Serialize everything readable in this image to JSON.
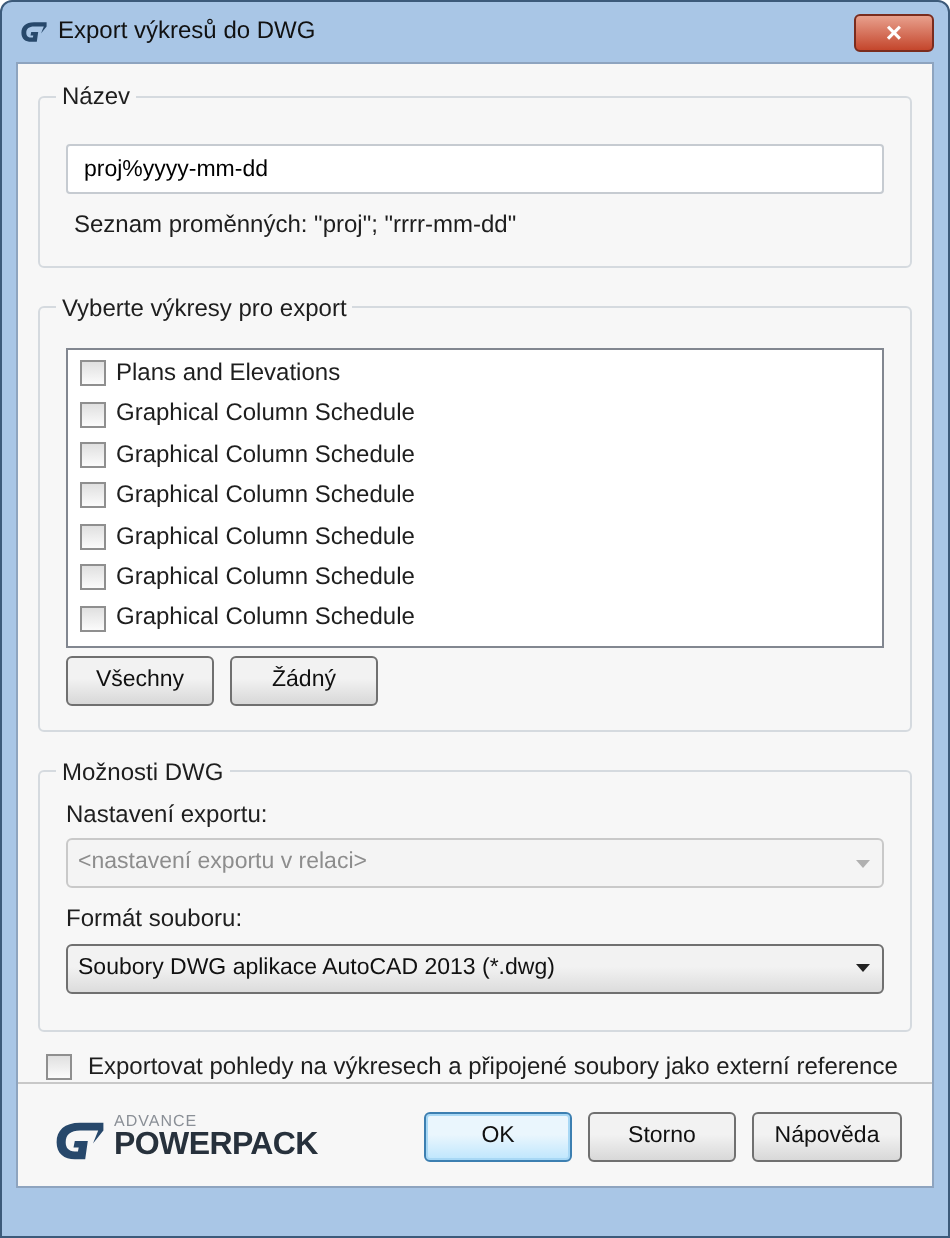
{
  "window": {
    "title": "Export výkresů do DWG",
    "close": "×"
  },
  "name_group": {
    "legend": "Název",
    "value": "proj%yyyy-mm-dd",
    "hint": "Seznam proměnných: \"proj\"; \"rrrr-mm-dd\""
  },
  "sheets_group": {
    "legend": "Vyberte výkresy pro export",
    "items": [
      {
        "label": "Plans and Elevations",
        "checked": false
      },
      {
        "label": "Graphical Column Schedule",
        "checked": false
      },
      {
        "label": "Graphical Column Schedule",
        "checked": false
      },
      {
        "label": "Graphical Column Schedule",
        "checked": false
      },
      {
        "label": "Graphical Column Schedule",
        "checked": false
      },
      {
        "label": "Graphical Column Schedule",
        "checked": false
      },
      {
        "label": "Graphical Column Schedule",
        "checked": false
      }
    ],
    "buttons": [
      "Všechny",
      "Žádný"
    ]
  },
  "dwg_group": {
    "legend": "Možnosti DWG",
    "fields": [
      {
        "label": "Nastavení exportu:",
        "value": "<nastavení exportu v relaci>",
        "disabled": true
      },
      {
        "label": "Formát souboru:",
        "value": "Soubory DWG aplikace AutoCAD 2013 (*.dwg)",
        "disabled": false
      }
    ]
  },
  "xref": {
    "label": "Exportovat pohledy na výkresech a připojené soubory jako externí reference",
    "checked": false
  },
  "logo": {
    "top": "ADVANCE",
    "bottom": "POWERPACK"
  },
  "buttons": [
    {
      "label": "OK",
      "default": true
    },
    {
      "label": "Storno",
      "default": false
    },
    {
      "label": "Nápověda",
      "default": false
    }
  ]
}
